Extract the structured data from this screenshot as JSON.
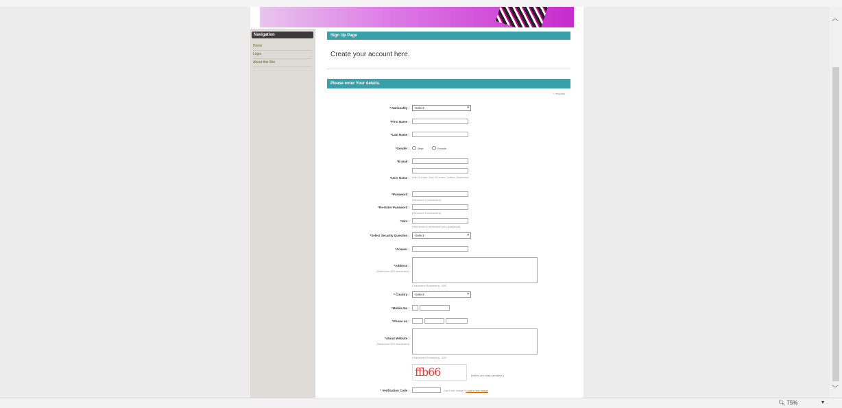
{
  "browser_menu": [
    "",
    ""
  ],
  "navigation": {
    "title": "Navigation",
    "items": [
      "Home",
      "Login",
      "About this Site"
    ]
  },
  "header": {
    "section_title": "Sign Up Page",
    "intro": "Create your account here.",
    "details_title": "Please enter Your details."
  },
  "form": {
    "required_note": "* required",
    "nationality_label": "* Nationality :",
    "nationality_value": "-Select-",
    "first_name_label": "*First Name :",
    "last_name_label": "*Last Name :",
    "gender_label": "*Gender :",
    "gender_male": "Male",
    "gender_female": "Female",
    "email_label": "*E-mail :",
    "username_label": "*User Name :",
    "username_hint": "(Min 3 chars. Max 20 chars. Letters, Numbers)",
    "password_label": "*Password :",
    "password_hint": "(Minimum 6 characters)",
    "retype_password_label": "*Re-Enter Password :",
    "retype_password_hint": "(Minimum 6 characters)",
    "hint_label": "*Hint :",
    "hint_hint": "(Hint word to remember your password)",
    "security_question_label": "*Select Security Question :",
    "security_question_value": "-Select-",
    "answer_label": "*Answer :",
    "address_label": "*Address :",
    "address_sub": "(Maximum 300 characters)",
    "address_counter": "Characters Remaining : 300",
    "country_label": "* Country :",
    "country_value": "-Select-",
    "mobile_label": "*Mobile No :",
    "phone_label": "*Phone no :",
    "about_label": "*About Website :",
    "about_sub": "(Maximum 300 characters)",
    "about_counter": "Characters Remaining : 300",
    "captcha_text": "ffb66",
    "captcha_case": "(letters are case-sensitive )",
    "verification_label": "* Verification Code :",
    "verification_hint": "Can't see image?",
    "new_image_link": "Load a new image"
  },
  "status": {
    "zoom": "75%"
  },
  "icons": {
    "scroll_up": "chevron-up-icon",
    "scroll_down": "chevron-down-icon",
    "zoom": "zoom-icon"
  }
}
